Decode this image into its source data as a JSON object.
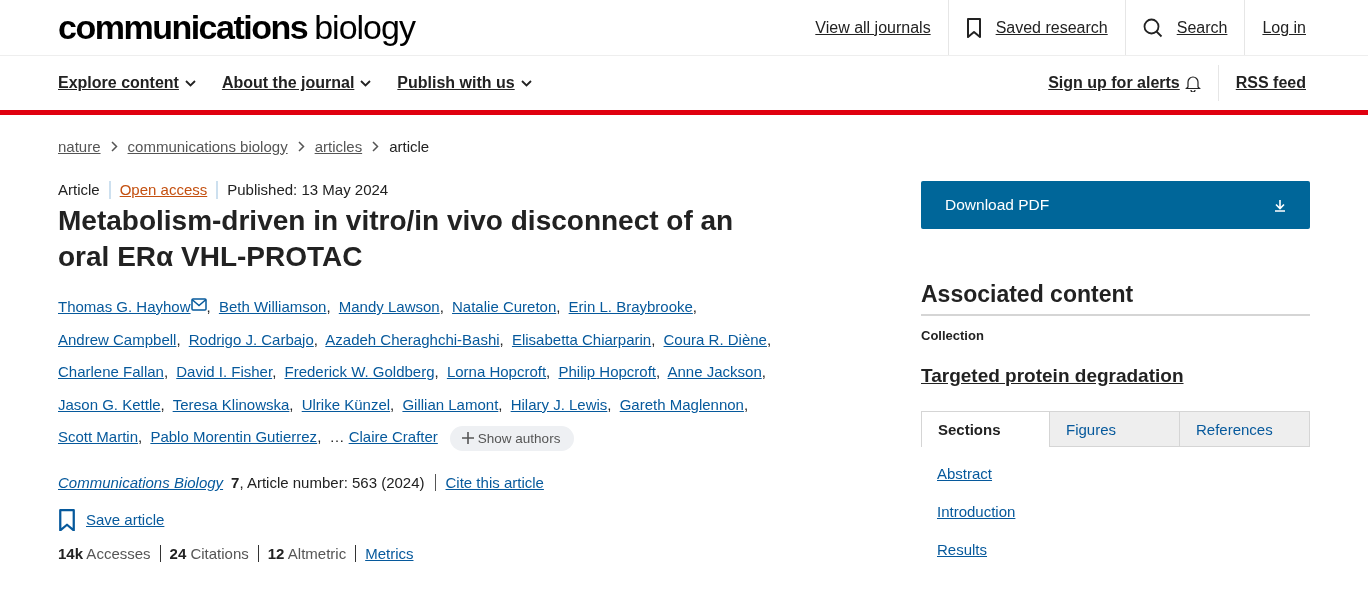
{
  "logo": {
    "bold": "communications",
    "light": "biology"
  },
  "top_links": [
    "View all journals",
    "Saved research",
    "Search",
    "Log in"
  ],
  "nav_menus": [
    "Explore content",
    "About the journal",
    "Publish with us"
  ],
  "nav_right": [
    "Sign up for alerts",
    "RSS feed"
  ],
  "breadcrumbs": [
    {
      "label": "nature",
      "current": false
    },
    {
      "label": "communications biology",
      "current": false
    },
    {
      "label": "articles",
      "current": false
    },
    {
      "label": "article",
      "current": true
    }
  ],
  "article": {
    "type": "Article",
    "access": "Open access",
    "published": "Published: 13 May 2024",
    "title": "Metabolism-driven in vitro/in vivo disconnect of an oral ERα VHL-PROTAC",
    "authors": [
      {
        "name": "Thomas G. Hayhow",
        "corresponding": true,
        "separator": ","
      },
      {
        "name": "Beth Williamson",
        "corresponding": false,
        "separator": ","
      },
      {
        "name": "Mandy Lawson",
        "corresponding": false,
        "separator": ","
      },
      {
        "name": "Natalie Cureton",
        "corresponding": false,
        "separator": ","
      },
      {
        "name": "Erin L. Braybrooke",
        "corresponding": false,
        "separator": ","
      },
      {
        "name": "Andrew Campbell",
        "corresponding": false,
        "separator": ","
      },
      {
        "name": "Rodrigo J. Carbajo",
        "corresponding": false,
        "separator": ","
      },
      {
        "name": "Azadeh Cheraghchi-Bashi",
        "corresponding": false,
        "separator": ","
      },
      {
        "name": "Elisabetta Chiarparin",
        "corresponding": false,
        "separator": ","
      },
      {
        "name": "Coura R. Diène",
        "corresponding": false,
        "separator": ","
      },
      {
        "name": "Charlene Fallan",
        "corresponding": false,
        "separator": ","
      },
      {
        "name": "David I. Fisher",
        "corresponding": false,
        "separator": ","
      },
      {
        "name": "Frederick W. Goldberg",
        "corresponding": false,
        "separator": ","
      },
      {
        "name": "Lorna Hopcroft",
        "corresponding": false,
        "separator": ","
      },
      {
        "name": "Philip Hopcroft",
        "corresponding": false,
        "separator": ","
      },
      {
        "name": "Anne Jackson",
        "corresponding": false,
        "separator": ","
      },
      {
        "name": "Jason G. Kettle",
        "corresponding": false,
        "separator": ","
      },
      {
        "name": "Teresa Klinowska",
        "corresponding": false,
        "separator": ","
      },
      {
        "name": "Ulrike Künzel",
        "corresponding": false,
        "separator": ","
      },
      {
        "name": "Gillian Lamont",
        "corresponding": false,
        "separator": ","
      },
      {
        "name": "Hilary J. Lewis",
        "corresponding": false,
        "separator": ","
      },
      {
        "name": "Gareth Maglennon",
        "corresponding": false,
        "separator": ","
      },
      {
        "name": "Scott Martin",
        "corresponding": false,
        "separator": ","
      },
      {
        "name": "Pablo Morentin Gutierrez",
        "corresponding": false,
        "separator": ","
      }
    ],
    "ellipsis": "…",
    "last_author": "Claire Crafter",
    "show_authors": "Show authors",
    "journal": "Communications Biology",
    "volume": "7",
    "article_number": ", Article number: 563 (2024)",
    "cite": "Cite this article",
    "save": "Save article",
    "metrics": [
      "**14k** Accesses",
      "**24** Citations",
      "**12** Altmetric"
    ],
    "metrics_link": "Metrics"
  },
  "sidebar": {
    "download": "Download PDF",
    "associated_heading": "Associated content",
    "collection_label": "Collection",
    "collection_title": "Targeted protein degradation",
    "tabs": [
      {
        "label": "Sections",
        "selected": true
      },
      {
        "label": "Figures",
        "selected": false
      },
      {
        "label": "References",
        "selected": false
      }
    ],
    "sections": [
      "Abstract",
      "Introduction",
      "Results"
    ]
  }
}
